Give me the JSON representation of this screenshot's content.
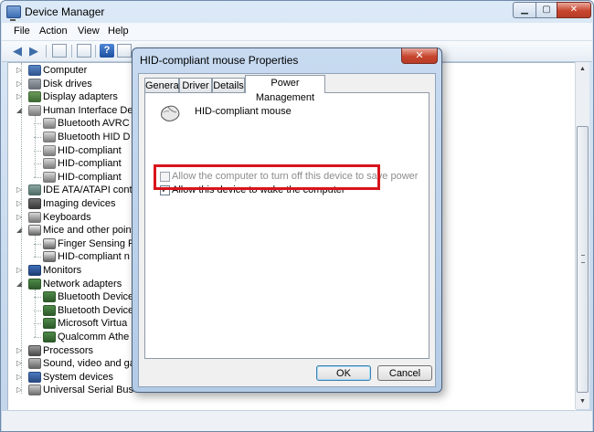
{
  "window": {
    "title": "Device Manager",
    "controls": {
      "minimize": "▁",
      "maximize": "▢",
      "close": "✕"
    }
  },
  "menu": [
    "File",
    "Action",
    "View",
    "Help"
  ],
  "toolbar": {
    "back_icon": "arrow-left-icon",
    "forward_icon": "arrow-right-icon",
    "help_label": "?"
  },
  "tree": [
    {
      "label": "Computer",
      "level": 1,
      "icon": "computer-icon",
      "toggle": "collapsed"
    },
    {
      "label": "Disk drives",
      "level": 1,
      "icon": "disk-drive-icon",
      "toggle": "collapsed"
    },
    {
      "label": "Display adapters",
      "level": 1,
      "icon": "display-adapter-icon",
      "toggle": "collapsed"
    },
    {
      "label": "Human Interface De",
      "level": 1,
      "icon": "hid-icon",
      "toggle": "expanded"
    },
    {
      "label": "Bluetooth AVRC",
      "level": 2,
      "icon": "hid-device-icon"
    },
    {
      "label": "Bluetooth HID D",
      "level": 2,
      "icon": "hid-device-icon"
    },
    {
      "label": "HID-compliant",
      "level": 2,
      "icon": "hid-device-icon"
    },
    {
      "label": "HID-compliant",
      "level": 2,
      "icon": "hid-device-icon"
    },
    {
      "label": "HID-compliant",
      "level": 2,
      "icon": "hid-device-icon"
    },
    {
      "label": "IDE ATA/ATAPI cont",
      "level": 1,
      "icon": "ide-controller-icon",
      "toggle": "collapsed"
    },
    {
      "label": "Imaging devices",
      "level": 1,
      "icon": "camera-icon",
      "toggle": "collapsed"
    },
    {
      "label": "Keyboards",
      "level": 1,
      "icon": "keyboard-icon",
      "toggle": "collapsed"
    },
    {
      "label": "Mice and other point",
      "level": 1,
      "icon": "mouse-icon",
      "toggle": "expanded"
    },
    {
      "label": "Finger Sensing P",
      "level": 2,
      "icon": "mouse-icon"
    },
    {
      "label": "HID-compliant n",
      "level": 2,
      "icon": "mouse-icon"
    },
    {
      "label": "Monitors",
      "level": 1,
      "icon": "monitor-icon",
      "toggle": "collapsed"
    },
    {
      "label": "Network adapters",
      "level": 1,
      "icon": "network-adapter-icon",
      "toggle": "expanded"
    },
    {
      "label": "Bluetooth Device",
      "level": 2,
      "icon": "network-adapter-icon"
    },
    {
      "label": "Bluetooth Device",
      "level": 2,
      "icon": "network-adapter-icon"
    },
    {
      "label": "Microsoft Virtua",
      "level": 2,
      "icon": "network-adapter-icon"
    },
    {
      "label": "Qualcomm Athe",
      "level": 2,
      "icon": "network-adapter-icon"
    },
    {
      "label": "Processors",
      "level": 1,
      "icon": "processor-icon",
      "toggle": "collapsed"
    },
    {
      "label": "Sound, video and ga",
      "level": 1,
      "icon": "speaker-icon",
      "toggle": "collapsed"
    },
    {
      "label": "System devices",
      "level": 1,
      "icon": "system-device-icon",
      "toggle": "collapsed"
    },
    {
      "label": "Universal Serial Bus controllers",
      "level": 1,
      "icon": "usb-icon",
      "toggle": "collapsed"
    }
  ],
  "dialog": {
    "title": "HID-compliant mouse Properties",
    "close_label": "✕",
    "tabs": [
      {
        "label": "General",
        "active": false
      },
      {
        "label": "Driver",
        "active": false
      },
      {
        "label": "Details",
        "active": false
      },
      {
        "label": "Power Management",
        "active": true
      }
    ],
    "device_name": "HID-compliant mouse",
    "options": [
      {
        "label": "Allow the computer to turn off this device to save power",
        "checked": false,
        "disabled": true
      },
      {
        "label": "Allow this device to wake the computer",
        "checked": true,
        "disabled": false
      }
    ],
    "ok_label": "OK",
    "cancel_label": "Cancel",
    "check_mark": "✓"
  },
  "colors": {
    "highlight": "#d8141c",
    "titlebar": "#c9dbef",
    "accent": "#3c7fb1"
  }
}
